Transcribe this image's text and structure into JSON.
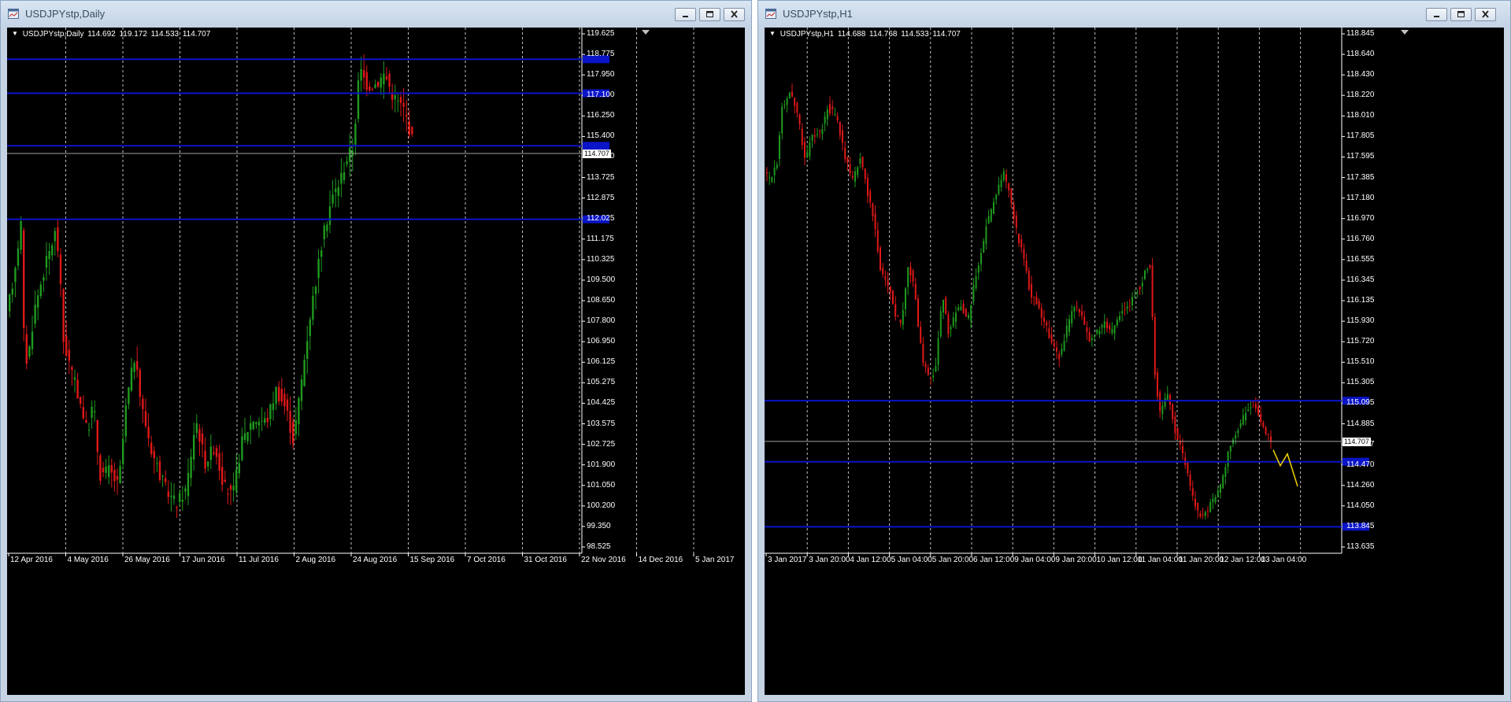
{
  "windows": [
    {
      "id": "left",
      "title": "USDJPYstp,Daily",
      "info": {
        "symbol": "USDJPYstp,Daily",
        "open": "114.692",
        "high": "119.172",
        "low": "114.533",
        "close": "114.707"
      },
      "price_axis": [
        "119.625",
        "118.775",
        "117.950",
        "117.100",
        "116.250",
        "115.400",
        "114.550",
        "113.725",
        "112.875",
        "112.025",
        "111.175",
        "110.325",
        "109.500",
        "108.650",
        "107.800",
        "106.950",
        "106.125",
        "105.275",
        "104.425",
        "103.575",
        "102.725",
        "101.900",
        "101.050",
        "100.200",
        "99.350",
        "98.525"
      ],
      "price_range": [
        98.525,
        119.625
      ],
      "date_labels": [
        "12 Apr 2016",
        "4 May 2016",
        "26 May 2016",
        "17 Jun 2016",
        "11 Jul 2016",
        "2 Aug 2016",
        "24 Aug 2016",
        "15 Sep 2016",
        "7 Oct 2016",
        "31 Oct 2016",
        "22 Nov 2016",
        "14 Dec 2016",
        "5 Jan 2017"
      ],
      "current_price": "114.707",
      "current_price_tag_text": "114.707",
      "horizontal_levels": [
        118.58,
        117.18,
        115.02,
        112.0
      ],
      "colors": {
        "bull": "#1f9a1f",
        "bear": "#e01818",
        "level": "#0a14c8",
        "grid": "#bfbfbf",
        "current": "#a0a0a0"
      },
      "price_path": [
        [
          0,
          108.0
        ],
        [
          8,
          109.5
        ],
        [
          18,
          111.8
        ],
        [
          21,
          107.5
        ],
        [
          26,
          106.0
        ],
        [
          35,
          108.3
        ],
        [
          48,
          110.0
        ],
        [
          62,
          111.5
        ],
        [
          66,
          110.5
        ],
        [
          72,
          107.0
        ],
        [
          84,
          105.5
        ],
        [
          95,
          104.3
        ],
        [
          102,
          103.2
        ],
        [
          110,
          104.5
        ],
        [
          118,
          101.5
        ],
        [
          130,
          101.7
        ],
        [
          142,
          101.0
        ],
        [
          152,
          104.5
        ],
        [
          162,
          106.3
        ],
        [
          172,
          104.2
        ],
        [
          184,
          102.5
        ],
        [
          200,
          101.0
        ],
        [
          215,
          100.3
        ],
        [
          228,
          100.9
        ],
        [
          240,
          103.8
        ],
        [
          252,
          102.0
        ],
        [
          264,
          102.7
        ],
        [
          276,
          101.0
        ],
        [
          287,
          100.6
        ],
        [
          298,
          102.8
        ],
        [
          312,
          103.8
        ],
        [
          330,
          103.7
        ],
        [
          342,
          105.0
        ],
        [
          355,
          104.2
        ],
        [
          364,
          102.9
        ],
        [
          372,
          104.8
        ],
        [
          385,
          108.0
        ],
        [
          400,
          111.0
        ],
        [
          412,
          112.8
        ],
        [
          422,
          113.5
        ],
        [
          432,
          114.5
        ],
        [
          440,
          115.0
        ],
        [
          445,
          117.0
        ],
        [
          448,
          118.2
        ],
        [
          458,
          117.5
        ],
        [
          470,
          117.6
        ],
        [
          480,
          118.0
        ],
        [
          490,
          117.1
        ],
        [
          505,
          116.5
        ],
        [
          518,
          114.9
        ]
      ]
    },
    {
      "id": "right",
      "title": "USDJPYstp,H1",
      "info": {
        "symbol": "USDJPYstp,H1",
        "open": "114.688",
        "high": "114.768",
        "low": "114.533",
        "close": "114.707"
      },
      "price_axis": [
        "118.845",
        "118.640",
        "118.430",
        "118.220",
        "118.010",
        "117.805",
        "117.595",
        "117.385",
        "117.180",
        "116.970",
        "116.760",
        "116.555",
        "116.345",
        "116.135",
        "115.930",
        "115.720",
        "115.510",
        "115.305",
        "115.095",
        "114.885",
        "114.707",
        "114.470",
        "114.260",
        "114.050",
        "113.845",
        "113.635"
      ],
      "price_range": [
        113.635,
        118.845
      ],
      "date_labels": [
        "3 Jan 2017",
        "3 Jan 20:00",
        "4 Jan 12:00",
        "5 Jan 04:00",
        "5 Jan 20:00",
        "6 Jan 12:00",
        "9 Jan 04:00",
        "9 Jan 20:00",
        "10 Jan 12:00",
        "11 Jan 04:00",
        "11 Jan 20:00",
        "12 Jan 12:00",
        "13 Jan 04:00"
      ],
      "current_price": "114.707",
      "current_price_tag_text": "114.707",
      "horizontal_levels": [
        115.12,
        114.5,
        113.84
      ],
      "colors": {
        "bull": "#1f9a1f",
        "bear": "#e01818",
        "level": "#0a14c8",
        "grid": "#bfbfbf",
        "current": "#a0a0a0",
        "projection": "#f0d000"
      },
      "price_path": [
        [
          0,
          117.45
        ],
        [
          6,
          117.35
        ],
        [
          16,
          117.55
        ],
        [
          22,
          118.1
        ],
        [
          32,
          118.25
        ],
        [
          42,
          118.05
        ],
        [
          52,
          117.55
        ],
        [
          60,
          117.8
        ],
        [
          72,
          117.85
        ],
        [
          80,
          118.1
        ],
        [
          92,
          118.0
        ],
        [
          102,
          117.6
        ],
        [
          112,
          117.35
        ],
        [
          122,
          117.6
        ],
        [
          132,
          117.2
        ],
        [
          140,
          116.9
        ],
        [
          148,
          116.4
        ],
        [
          158,
          116.3
        ],
        [
          166,
          116.0
        ],
        [
          174,
          115.9
        ],
        [
          182,
          116.5
        ],
        [
          190,
          116.3
        ],
        [
          196,
          115.8
        ],
        [
          202,
          115.5
        ],
        [
          210,
          115.3
        ],
        [
          218,
          115.5
        ],
        [
          226,
          116.2
        ],
        [
          234,
          115.8
        ],
        [
          242,
          116.0
        ],
        [
          250,
          116.1
        ],
        [
          258,
          115.9
        ],
        [
          266,
          116.3
        ],
        [
          274,
          116.55
        ],
        [
          282,
          116.9
        ],
        [
          290,
          117.1
        ],
        [
          298,
          117.3
        ],
        [
          304,
          117.45
        ],
        [
          312,
          117.2
        ],
        [
          320,
          116.85
        ],
        [
          328,
          116.6
        ],
        [
          338,
          116.2
        ],
        [
          346,
          116.1
        ],
        [
          356,
          115.9
        ],
        [
          366,
          115.7
        ],
        [
          374,
          115.55
        ],
        [
          384,
          115.85
        ],
        [
          394,
          116.1
        ],
        [
          402,
          116.0
        ],
        [
          412,
          115.75
        ],
        [
          420,
          115.8
        ],
        [
          432,
          115.9
        ],
        [
          440,
          115.8
        ],
        [
          450,
          116.0
        ],
        [
          460,
          116.05
        ],
        [
          470,
          116.2
        ],
        [
          478,
          116.3
        ],
        [
          484,
          116.45
        ],
        [
          490,
          116.5
        ],
        [
          496,
          115.4
        ],
        [
          502,
          115.0
        ],
        [
          512,
          115.2
        ],
        [
          522,
          114.8
        ],
        [
          532,
          114.55
        ],
        [
          542,
          114.2
        ],
        [
          552,
          113.95
        ],
        [
          562,
          114.0
        ],
        [
          572,
          114.15
        ],
        [
          580,
          114.25
        ],
        [
          588,
          114.55
        ],
        [
          596,
          114.75
        ],
        [
          604,
          114.85
        ],
        [
          612,
          115.05
        ],
        [
          620,
          115.1
        ],
        [
          628,
          114.95
        ],
        [
          636,
          114.8
        ],
        [
          644,
          114.7
        ]
      ],
      "projection_path": [
        [
          644,
          114.62
        ],
        [
          653,
          114.46
        ],
        [
          662,
          114.58
        ],
        [
          675,
          114.25
        ]
      ]
    }
  ]
}
